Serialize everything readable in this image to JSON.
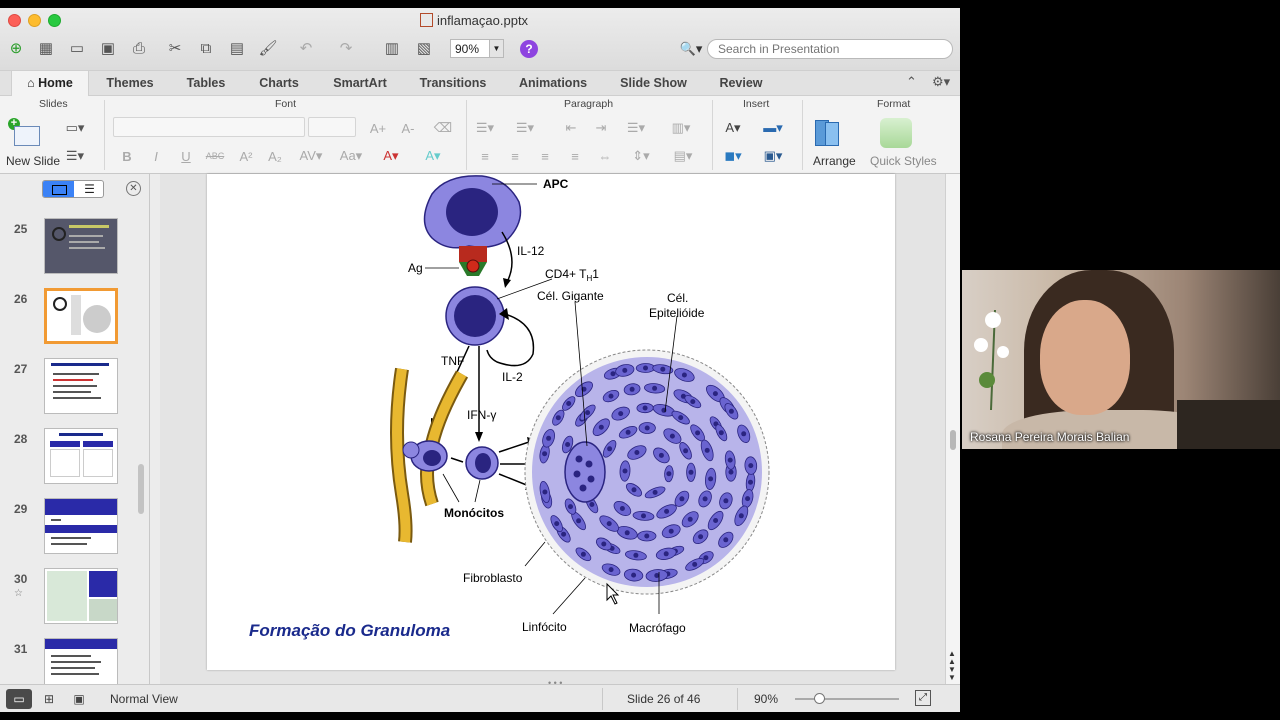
{
  "window": {
    "title": "inflamaçao.pptx",
    "zoom": "90%",
    "search_placeholder": "Search in Presentation"
  },
  "tabs": [
    "Home",
    "Themes",
    "Tables",
    "Charts",
    "SmartArt",
    "Transitions",
    "Animations",
    "Slide Show",
    "Review"
  ],
  "active_tab": "Home",
  "ribbon": {
    "groups": [
      "Slides",
      "Font",
      "Paragraph",
      "Insert",
      "Format"
    ],
    "new_slide": "New Slide",
    "arrange": "Arrange",
    "quick_styles": "Quick Styles"
  },
  "thumbnails": [
    {
      "number": "25"
    },
    {
      "number": "26"
    },
    {
      "number": "27"
    },
    {
      "number": "28"
    },
    {
      "number": "29"
    },
    {
      "number": "30"
    },
    {
      "number": "31"
    }
  ],
  "selected_slide": 26,
  "slide": {
    "title": "Formação do Granuloma",
    "labels": {
      "apc": "APC",
      "ag": "Ag",
      "il12": "IL-12",
      "cd4": "CD4+ T",
      "cd4_sub": "H",
      "cd4_num": "1",
      "gigante": "Cél. Gigante",
      "epitelioide_1": "Cél.",
      "epitelioide_2": "Epitelióide",
      "tnf": "TNF",
      "il2": "IL-2",
      "ifn": "IFN-γ",
      "monocitos": "Monócitos",
      "fibroblasto": "Fibroblasto",
      "linfocito": "Linfócito",
      "macrofago": "Macrófago"
    }
  },
  "status": {
    "view": "Normal View",
    "slide_info": "Slide 26 of 46",
    "zoom": "90%"
  },
  "video": {
    "participant_name": "Rosana Pereira Morais Balian"
  },
  "colors": {
    "cell_fill": "#8c86e0",
    "nucleus": "#2a2480",
    "title_blue": "#1a2a8c",
    "selection_orange": "#f19a33",
    "accent_blue": "#3b82f6"
  }
}
